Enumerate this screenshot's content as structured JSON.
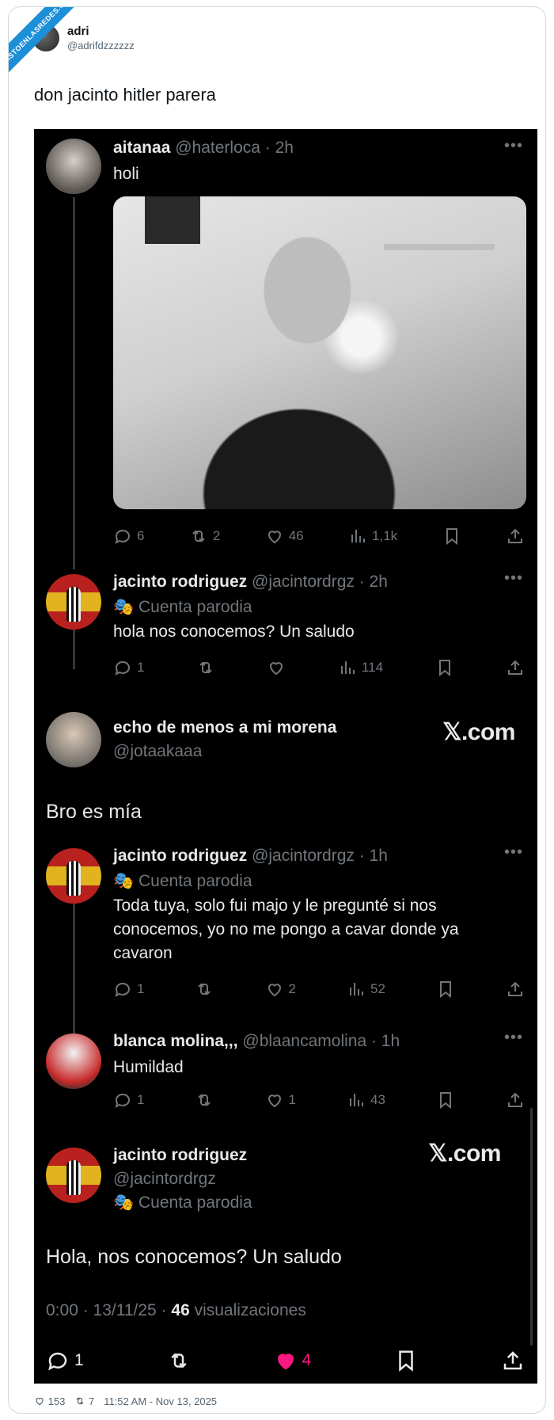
{
  "watermark": "VISTOENLASREDES.COM",
  "author": {
    "name": "adri",
    "handle": "@adrifdzzzzzz"
  },
  "tweet_text": "don jacinto hitler parera",
  "screenshot": {
    "post1": {
      "name": "aitanaa",
      "meta": "@haterloca · 2h",
      "text": "holi",
      "replies": "6",
      "reposts": "2",
      "likes": "46",
      "views": "1,1k"
    },
    "reply1": {
      "name": "jacinto rodriguez",
      "meta": "@jacintordrgz · 2h",
      "parody": "Cuenta parodia",
      "text": "hola nos conocemos? Un saludo",
      "replies": "1",
      "views": "114"
    },
    "embed1": {
      "name": "echo de menos a mi morena",
      "handle": "@jotaakaaa",
      "brand": "𝕏.com",
      "text": "Bro es mía"
    },
    "reply2": {
      "name": "jacinto rodriguez",
      "meta": "@jacintordrgz · 1h",
      "parody": "Cuenta parodia",
      "text": "Toda tuya, solo fui majo y le pregunté si nos conocemos, yo no me pongo a cavar donde ya cavaron",
      "replies": "1",
      "likes": "2",
      "views": "52"
    },
    "reply3": {
      "name": "blanca molina,,,",
      "meta": "@blaancamolina · 1h",
      "text": "Humildad",
      "replies": "1",
      "likes": "1",
      "views": "43"
    },
    "embed2": {
      "name": "jacinto rodriguez",
      "handle": "@jacintordrgz",
      "parody": "Cuenta parodia",
      "brand": "𝕏.com",
      "text": "Hola, nos conocemos? Un saludo",
      "time": "0:00 · 13/11/25 · ",
      "views_count": "46",
      "views_label": " visualizaciones",
      "replies": "1",
      "likes": "4"
    }
  },
  "footer": {
    "likes": "153",
    "reposts": "7",
    "date": "11:52 AM - Nov 13, 2025"
  },
  "colors": {
    "like_pink": "#f91880",
    "ribbon_blue": "#1d8fd8"
  }
}
